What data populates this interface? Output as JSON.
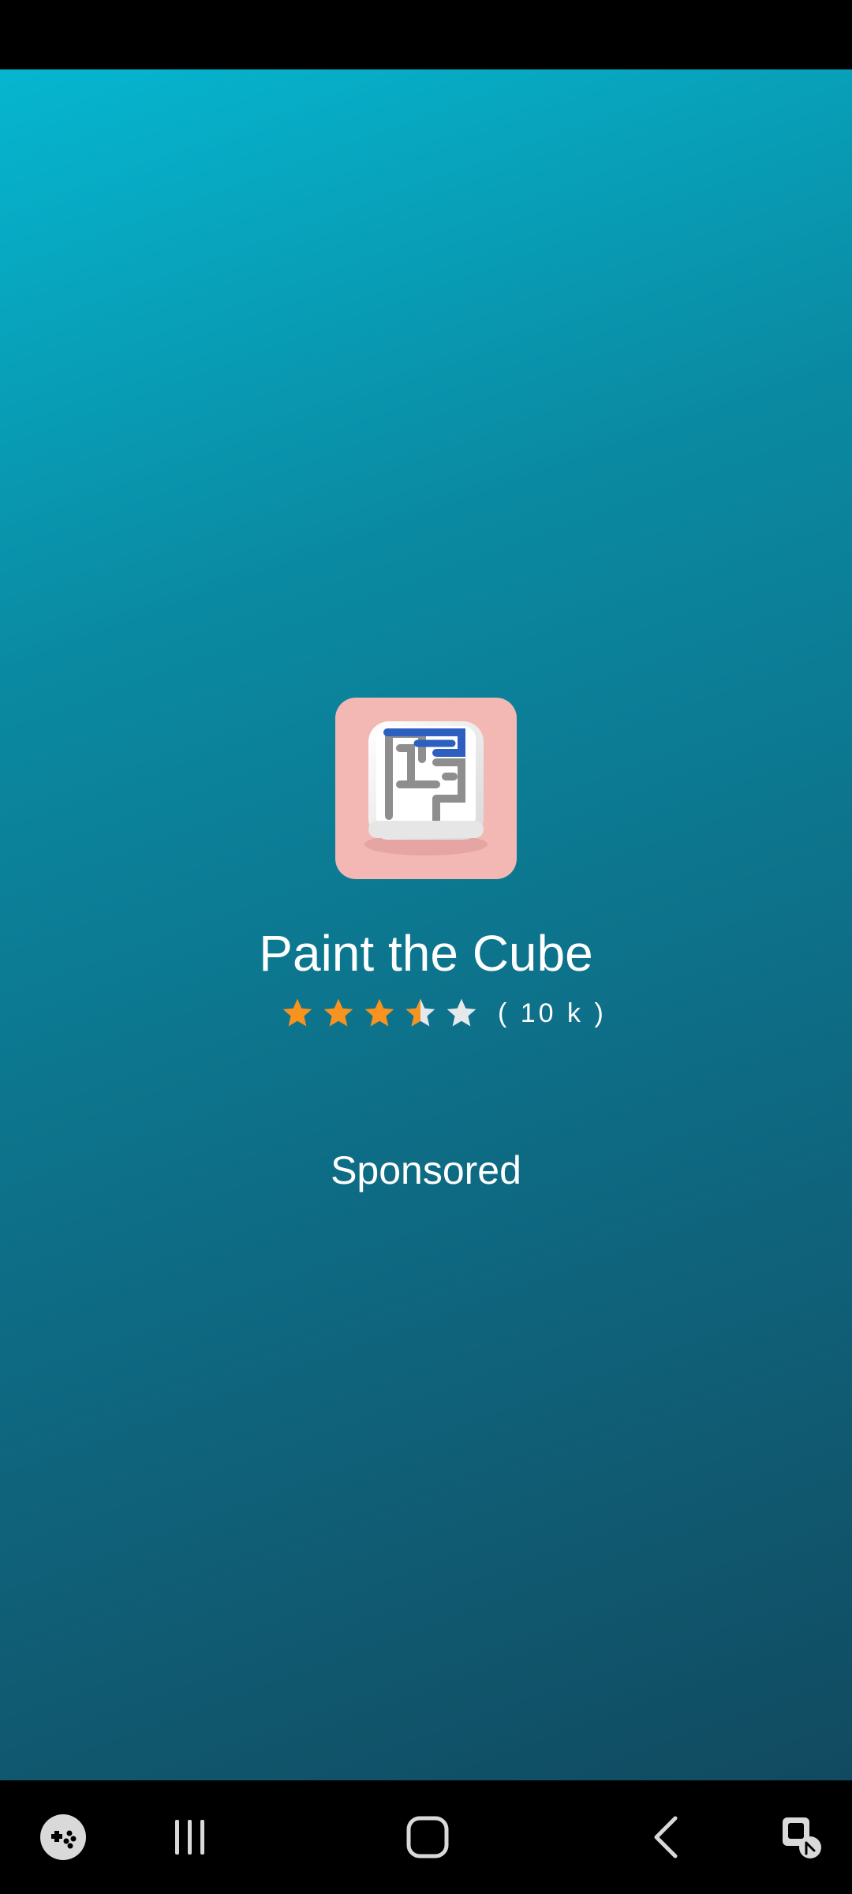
{
  "app": {
    "name": "Paint the Cube",
    "rating": 3.5,
    "rating_max": 5,
    "rating_count": "( 10 k )",
    "sponsored_label": "Sponsored",
    "icon": "paint-the-cube-maze-icon"
  },
  "colors": {
    "gradient_top": "#06b6d0",
    "gradient_bottom": "#114a60",
    "star_filled": "#f7931e",
    "star_empty": "#e6e9ec",
    "icon_bg": "#f3b7b4"
  },
  "nav_bar": {
    "items": [
      {
        "name": "game-launcher-icon"
      },
      {
        "name": "recent-apps-icon"
      },
      {
        "name": "home-icon"
      },
      {
        "name": "back-icon"
      },
      {
        "name": "assistant-touch-icon"
      }
    ]
  }
}
